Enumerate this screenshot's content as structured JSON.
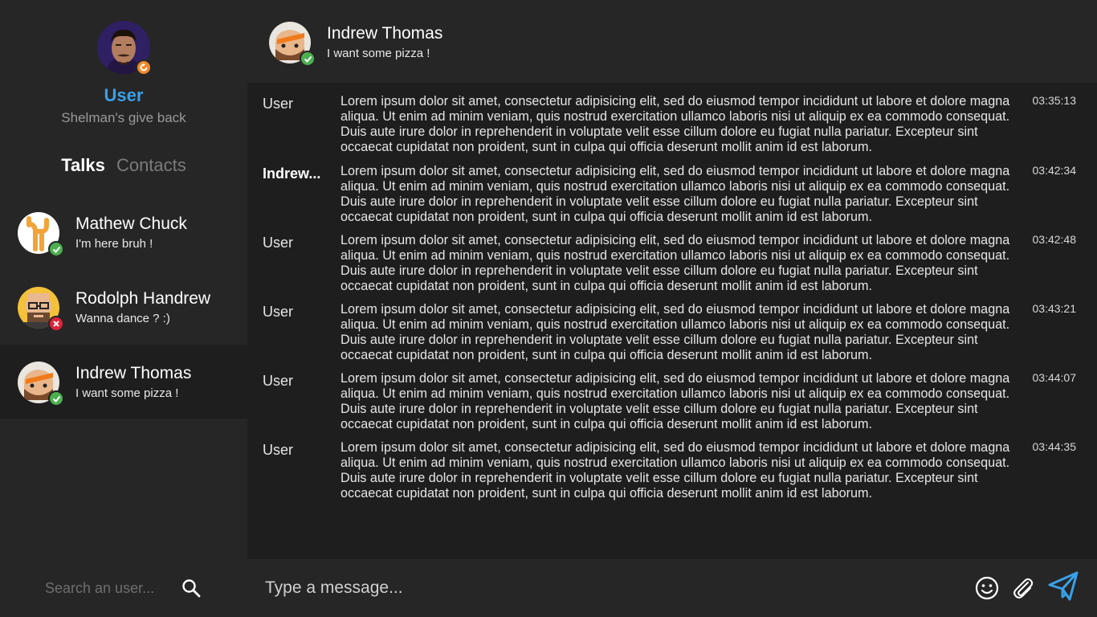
{
  "profile": {
    "name": "User",
    "status": "Shelman's give back"
  },
  "tabs": {
    "talks": "Talks",
    "contacts": "Contacts"
  },
  "contacts": [
    {
      "name": "Mathew Chuck",
      "message": "I'm here bruh !",
      "status": "online"
    },
    {
      "name": "Rodolph Handrew",
      "message": "Wanna dance ? :)",
      "status": "offline"
    },
    {
      "name": "Indrew Thomas",
      "message": "I want some pizza !",
      "status": "online"
    }
  ],
  "search": {
    "placeholder": "Search an user..."
  },
  "chat": {
    "name": "Indrew Thomas",
    "status_message": "I want some pizza !"
  },
  "messages": [
    {
      "author": "User",
      "time": "03:35:13",
      "text": "Lorem ipsum dolor sit amet, consectetur adipisicing elit, sed do eiusmod tempor incididunt ut labore et dolore magna aliqua. Ut enim ad minim veniam, quis nostrud exercitation ullamco laboris nisi ut aliquip ex ea commodo consequat. Duis aute irure dolor in reprehenderit in voluptate velit esse cillum dolore eu fugiat nulla pariatur. Excepteur sint occaecat cupidatat non proident, sunt in culpa qui officia deserunt mollit anim id est laborum."
    },
    {
      "author": "Indrew...",
      "time": "03:42:34",
      "text": "Lorem ipsum dolor sit amet, consectetur adipisicing elit, sed do eiusmod tempor incididunt ut labore et dolore magna aliqua. Ut enim ad minim veniam, quis nostrud exercitation ullamco laboris nisi ut aliquip ex ea commodo consequat. Duis aute irure dolor in reprehenderit in voluptate velit esse cillum dolore eu fugiat nulla pariatur. Excepteur sint occaecat cupidatat non proident, sunt in culpa qui officia deserunt mollit anim id est laborum."
    },
    {
      "author": "User",
      "time": "03:42:48",
      "text": "Lorem ipsum dolor sit amet, consectetur adipisicing elit, sed do eiusmod tempor incididunt ut labore et dolore magna aliqua. Ut enim ad minim veniam, quis nostrud exercitation ullamco laboris nisi ut aliquip ex ea commodo consequat. Duis aute irure dolor in reprehenderit in voluptate velit esse cillum dolore eu fugiat nulla pariatur. Excepteur sint occaecat cupidatat non proident, sunt in culpa qui officia deserunt mollit anim id est laborum."
    },
    {
      "author": "User",
      "time": "03:43:21",
      "text": "Lorem ipsum dolor sit amet, consectetur adipisicing elit, sed do eiusmod tempor incididunt ut labore et dolore magna aliqua. Ut enim ad minim veniam, quis nostrud exercitation ullamco laboris nisi ut aliquip ex ea commodo consequat. Duis aute irure dolor in reprehenderit in voluptate velit esse cillum dolore eu fugiat nulla pariatur. Excepteur sint occaecat cupidatat non proident, sunt in culpa qui officia deserunt mollit anim id est laborum."
    },
    {
      "author": "User",
      "time": "03:44:07",
      "text": "Lorem ipsum dolor sit amet, consectetur adipisicing elit, sed do eiusmod tempor incididunt ut labore et dolore magna aliqua. Ut enim ad minim veniam, quis nostrud exercitation ullamco laboris nisi ut aliquip ex ea commodo consequat. Duis aute irure dolor in reprehenderit in voluptate velit esse cillum dolore eu fugiat nulla pariatur. Excepteur sint occaecat cupidatat non proident, sunt in culpa qui officia deserunt mollit anim id est laborum."
    },
    {
      "author": "User",
      "time": "03:44:35",
      "text": "Lorem ipsum dolor sit amet, consectetur adipisicing elit, sed do eiusmod tempor incididunt ut labore et dolore magna aliqua. Ut enim ad minim veniam, quis nostrud exercitation ullamco laboris nisi ut aliquip ex ea commodo consequat. Duis aute irure dolor in reprehenderit in voluptate velit esse cillum dolore eu fugiat nulla pariatur. Excepteur sint occaecat cupidatat non proident, sunt in culpa qui officia deserunt mollit anim id est laborum."
    }
  ],
  "composer": {
    "placeholder": "Type a message..."
  },
  "colors": {
    "accent": "#3aa0e8",
    "online": "#4caf50",
    "offline": "#e0223a",
    "away": "#ef8a2c"
  },
  "icons": {
    "emoji": "smiley-icon",
    "attach": "paperclip-icon",
    "send": "paper-plane-icon",
    "search": "search-icon"
  }
}
